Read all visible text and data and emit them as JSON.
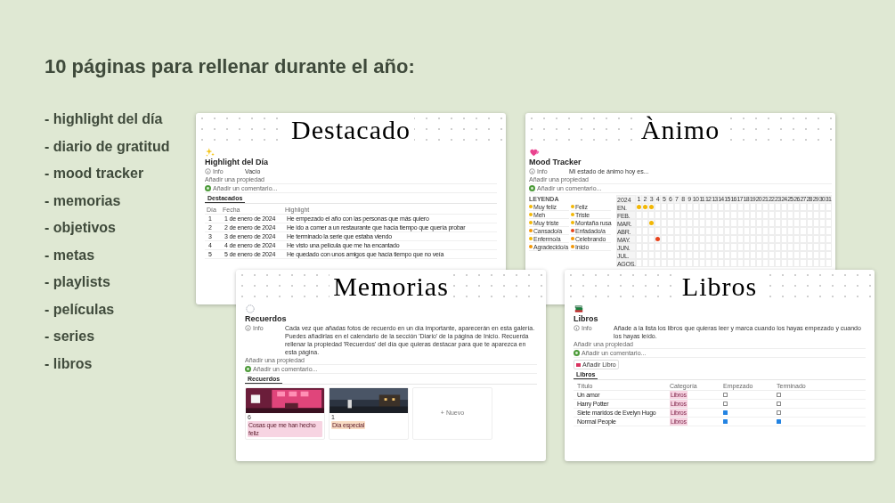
{
  "heading": "10 páginas para rellenar durante el año:",
  "list": [
    "- highlight del día",
    "- diario de gratitud",
    "- mood tracker",
    "- memorias",
    "- objetivos",
    "- metas",
    "- playlists",
    "- películas",
    "- series",
    "- libros"
  ],
  "cards": [
    {
      "kind": "highlights",
      "banner": "Destacado",
      "title": "Highlight del Día",
      "info_label": "Info",
      "info_value": "Vacío",
      "add_property": "Añadir una propiedad",
      "comment": "Añadir un comentario...",
      "tab": "Destacados",
      "columns": [
        "Día",
        "Fecha",
        "Highlight"
      ],
      "rows": [
        [
          "1",
          "1 de enero de 2024",
          "He empezado el año con las personas que más quiero"
        ],
        [
          "2",
          "2 de enero de 2024",
          "He ido a comer a un restaurante que hacía tiempo que quería probar"
        ],
        [
          "3",
          "3 de enero de 2024",
          "He terminado la serie que estaba viendo"
        ],
        [
          "4",
          "4 de enero de 2024",
          "He visto una película que me ha encantado"
        ],
        [
          "5",
          "5 de enero de 2024",
          "He quedado con unos amigos que hacía tiempo que no veía"
        ]
      ]
    },
    {
      "kind": "mood",
      "banner": "Ànimo",
      "title": "Mood Tracker",
      "info_label": "Info",
      "info_value": "Mi estado de ánimo hoy es...",
      "add_property": "Añadir una propiedad",
      "comment": "Añadir un comentario...",
      "legend_title": "LEYENDA",
      "legend": [
        {
          "label": "Muy feliz",
          "color": "#f2b705"
        },
        {
          "label": "Feliz",
          "color": "#f2b705"
        },
        {
          "label": "Meh",
          "color": "#f2b705"
        },
        {
          "label": "Triste",
          "color": "#f2b705"
        },
        {
          "label": "Muy triste",
          "color": "#f2b705"
        },
        {
          "label": "Montaña rusa",
          "color": "#f2b705"
        },
        {
          "label": "Cansado/a",
          "color": "#f29705"
        },
        {
          "label": "Enfadado/a",
          "color": "#e8431c"
        },
        {
          "label": "Enfermo/a",
          "color": "#f2b705"
        },
        {
          "label": "Celebrando",
          "color": "#f29705"
        },
        {
          "label": "Agradecido/a",
          "color": "#f29705"
        },
        {
          "label": "Inicio",
          "color": "#f29705"
        }
      ],
      "year": "2024",
      "days": [
        "1",
        "2",
        "3",
        "4",
        "5",
        "6",
        "7",
        "8",
        "9",
        "10",
        "11",
        "12",
        "13",
        "14",
        "15",
        "16",
        "17",
        "18",
        "19",
        "20",
        "21",
        "22",
        "23",
        "24",
        "25",
        "26",
        "27",
        "28",
        "29",
        "30",
        "31"
      ],
      "months": [
        {
          "label": "EN.",
          "marks": [
            {
              "marked": true,
              "color": "#f2b705"
            },
            {
              "marked": true,
              "color": "#f2b705"
            },
            {
              "marked": true,
              "color": "#f2b705"
            },
            {
              "marked": false
            },
            {
              "marked": false
            }
          ]
        },
        {
          "label": "FEB.",
          "marks": [
            {
              "marked": false
            },
            {
              "marked": false
            },
            {
              "marked": false
            },
            {
              "marked": false
            },
            {
              "marked": false
            }
          ]
        },
        {
          "label": "MAR.",
          "marks": [
            {
              "marked": false
            },
            {
              "marked": false
            },
            {
              "marked": true,
              "color": "#f2b705"
            },
            {
              "marked": false
            },
            {
              "marked": false
            }
          ]
        },
        {
          "label": "ABR.",
          "marks": [
            {
              "marked": false
            },
            {
              "marked": false
            },
            {
              "marked": false
            },
            {
              "marked": false
            },
            {
              "marked": false
            }
          ]
        },
        {
          "label": "MAY.",
          "marks": [
            {
              "marked": false
            },
            {
              "marked": false
            },
            {
              "marked": false
            },
            {
              "marked": true,
              "color": "#e8431c"
            },
            {
              "marked": false
            }
          ]
        },
        {
          "label": "JUN.",
          "marks": [
            {
              "marked": false
            },
            {
              "marked": false
            },
            {
              "marked": false
            },
            {
              "marked": false
            },
            {
              "marked": false
            }
          ]
        },
        {
          "label": "JUL.",
          "marks": [
            {
              "marked": false
            },
            {
              "marked": false
            },
            {
              "marked": false
            },
            {
              "marked": false
            },
            {
              "marked": false
            }
          ]
        },
        {
          "label": "AGOS.",
          "marks": [
            {
              "marked": false
            },
            {
              "marked": false
            },
            {
              "marked": false
            },
            {
              "marked": false
            },
            {
              "marked": false
            }
          ]
        }
      ]
    },
    {
      "kind": "memories",
      "banner": "Memorias",
      "title": "Recuerdos",
      "info_label": "Info",
      "info_value": "Cada vez que añadas fotos de recuerdo en un día importante, aparecerán en esta galería. Puedes añadirlas en el calendario de la sección 'Diario' de la página de Inicio. Recuerda rellenar la propiedad 'Recuerdos' del día que quieras destacar para que te aparezca en esta página.",
      "add_property": "Añadir una propiedad",
      "comment": "Añadir un comentario...",
      "tab": "Recuerdos",
      "gallery": [
        {
          "kind": "picture",
          "name": "6",
          "tag": "Cosas que me han hecho feliz",
          "color": "#f7d4e2"
        },
        {
          "kind": "picture",
          "name": "1",
          "tag": "Día especial",
          "color": "#f9dcc4"
        }
      ],
      "new_label": "+ Nuevo"
    },
    {
      "kind": "books",
      "banner": "Libros",
      "title": "Libros",
      "info_label": "Info",
      "info_value": "Añade a la lista los libros que quieras leer y marca cuando los hayas empezado y cuando los hayas leído.",
      "add_property": "Añadir una propiedad",
      "comment": "Añadir un comentario...",
      "add_button": "Añadir Libro",
      "tab": "Libros",
      "columns": [
        "Título",
        "Categoría",
        "Empezado",
        "Terminado"
      ],
      "rows": [
        {
          "title": "Un amor",
          "category": "Libros",
          "started": false,
          "finished": false
        },
        {
          "title": "Harry Potter",
          "category": "Libros",
          "started": false,
          "finished": false
        },
        {
          "title": "Siete maridos de Evelyn Hugo",
          "category": "Libros",
          "started": true,
          "finished": false
        },
        {
          "title": "Normal People",
          "category": "Libros",
          "started": true,
          "finished": true
        }
      ]
    }
  ]
}
